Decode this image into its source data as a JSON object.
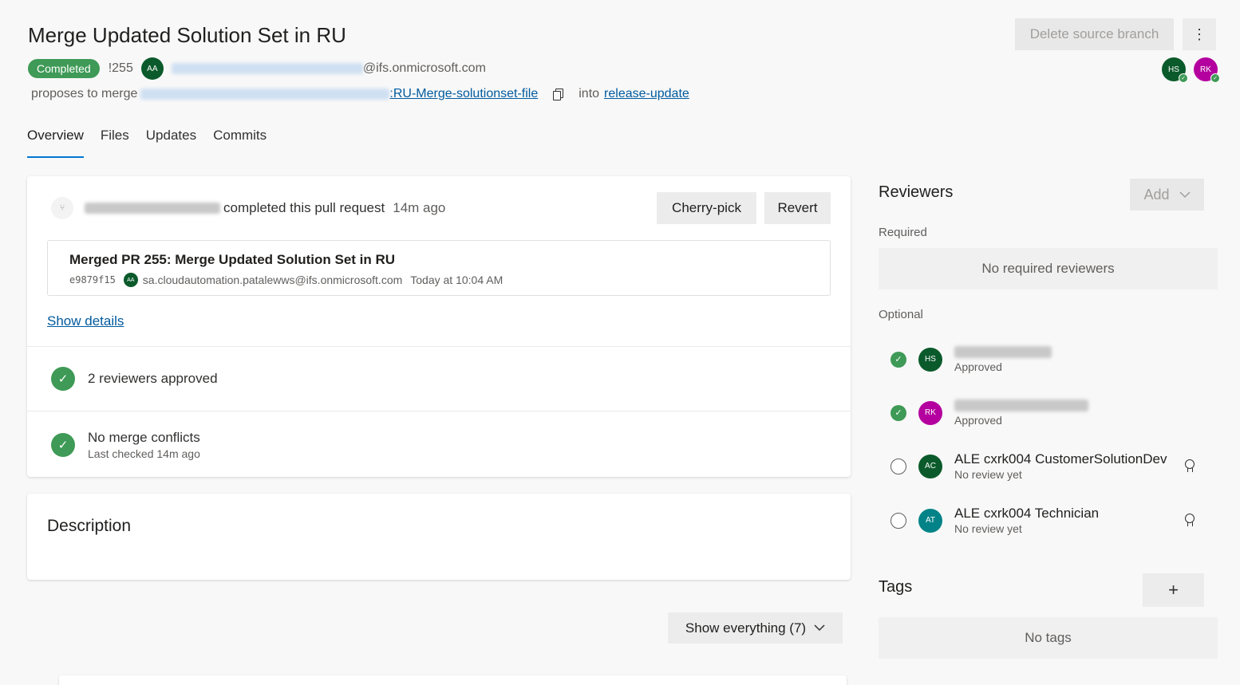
{
  "header": {
    "title": "Merge Updated Solution Set in RU",
    "status_badge": "Completed",
    "pr_number": "!255",
    "author_initials": "AA",
    "author_domain": "@ifs.onmicrosoft.com",
    "proposes_text": "proposes to merge",
    "source_branch_suffix": ":RU-Merge-solutionset-file",
    "into_text": "into",
    "target_branch": "release-update",
    "delete_branch_label": "Delete source branch",
    "more_label": "⋮",
    "reviewer_avatars": [
      {
        "initials": "HS",
        "color": "#0b5a2b"
      },
      {
        "initials": "RK",
        "color": "#b4009e"
      }
    ]
  },
  "tabs": [
    {
      "label": "Overview",
      "active": true
    },
    {
      "label": "Files",
      "active": false
    },
    {
      "label": "Updates",
      "active": false
    },
    {
      "label": "Commits",
      "active": false
    }
  ],
  "status_card": {
    "event_text": "completed this pull request",
    "event_time": "14m ago",
    "cherry_pick_label": "Cherry-pick",
    "revert_label": "Revert",
    "commit": {
      "title": "Merged PR 255: Merge Updated Solution Set in RU",
      "hash": "e9879f15",
      "author_initials": "AA",
      "author": "sa.cloudautomation.patalewws@ifs.onmicrosoft.com",
      "time": "Today at 10:04 AM"
    },
    "show_details_label": "Show details",
    "reviewers_approved": "2 reviewers approved",
    "merge_conflicts": "No merge conflicts",
    "merge_checked": "Last checked 14m ago"
  },
  "description": {
    "title": "Description"
  },
  "show_everything_label": "Show everything (7)",
  "reviewers": {
    "title": "Reviewers",
    "add_label": "Add",
    "required_label": "Required",
    "required_empty": "No required reviewers",
    "optional_label": "Optional",
    "optional": [
      {
        "initials": "HS",
        "name": "",
        "status": "Approved",
        "approved": true,
        "color": "#0b5a2b"
      },
      {
        "initials": "RK",
        "name": "",
        "status": "Approved",
        "approved": true,
        "color": "#b4009e"
      },
      {
        "initials": "AC",
        "name": "ALE cxrk004 CustomerSolutionDev",
        "status": "No review yet",
        "approved": false,
        "color": "#0b5a2b"
      },
      {
        "initials": "AT",
        "name": "ALE cxrk004 Technician",
        "status": "No review yet",
        "approved": false,
        "color": "#038387"
      }
    ]
  },
  "tags": {
    "title": "Tags",
    "add_label": "+",
    "empty": "No tags"
  },
  "icons": {
    "check": "✓",
    "chevron": "chevron-down-icon",
    "branch": "branch-icon",
    "copy": "copy-icon",
    "award": "award-icon"
  },
  "colors": {
    "accent": "#0078d4",
    "success": "#3e9a56",
    "link": "#005a9e"
  }
}
